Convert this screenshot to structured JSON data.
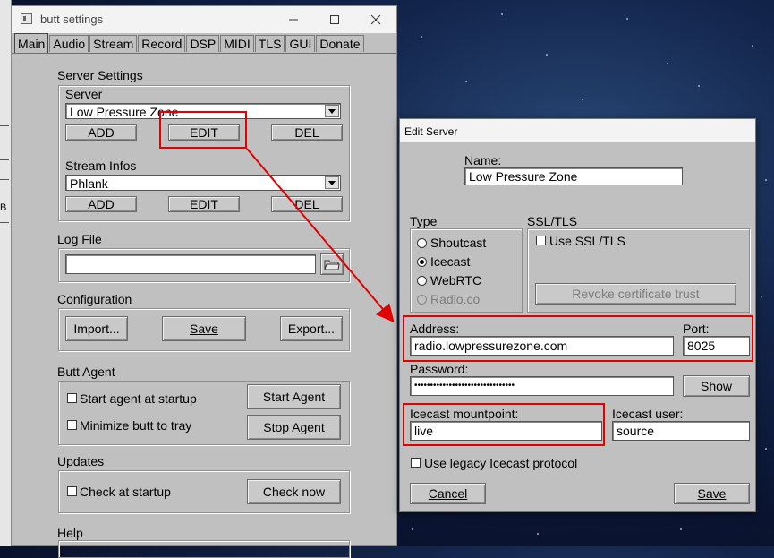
{
  "window": {
    "title": "butt settings",
    "tabs": [
      "Main",
      "Audio",
      "Stream",
      "Record",
      "DSP",
      "MIDI",
      "TLS",
      "GUI",
      "Donate"
    ],
    "active_tab": "Main"
  },
  "left_partial": {
    "fragment": "B"
  },
  "server_settings": {
    "title": "Server Settings",
    "server_label": "Server",
    "server_value": "Low Pressure Zone",
    "stream_infos_label": "Stream Infos",
    "stream_infos_value": "Phlank",
    "add": "ADD",
    "edit": "EDIT",
    "del": "DEL"
  },
  "log_file": {
    "title": "Log File",
    "value": ""
  },
  "configuration": {
    "title": "Configuration",
    "import": "Import...",
    "save": "Save",
    "export": "Export..."
  },
  "butt_agent": {
    "title": "Butt Agent",
    "start_at_startup": "Start agent at startup",
    "minimize_to_tray": "Minimize butt to tray",
    "start_agent": "Start Agent",
    "stop_agent": "Stop Agent"
  },
  "updates": {
    "title": "Updates",
    "check_at_startup": "Check at startup",
    "check_now": "Check now"
  },
  "help": {
    "title": "Help"
  },
  "dialog": {
    "title": "Edit Server",
    "name_label": "Name:",
    "name_value": "Low Pressure Zone",
    "type_label": "Type",
    "types": [
      "Shoutcast",
      "Icecast",
      "WebRTC",
      "Radio.co"
    ],
    "selected_type": "Icecast",
    "ssl_label": "SSL/TLS",
    "use_ssl": "Use SSL/TLS",
    "revoke": "Revoke certificate trust",
    "address_label": "Address:",
    "address_value": "radio.lowpressurezone.com",
    "port_label": "Port:",
    "port_value": "8025",
    "password_label": "Password:",
    "password_value": "••••••••••••••••••••••••••••••••",
    "show": "Show",
    "mount_label": "Icecast mountpoint:",
    "mount_value": "live",
    "user_label": "Icecast user:",
    "user_value": "source",
    "legacy": "Use legacy Icecast protocol",
    "cancel": "Cancel",
    "save": "Save"
  },
  "colors": {
    "highlight": "#e00000",
    "window_bg": "#c0c0c0"
  }
}
